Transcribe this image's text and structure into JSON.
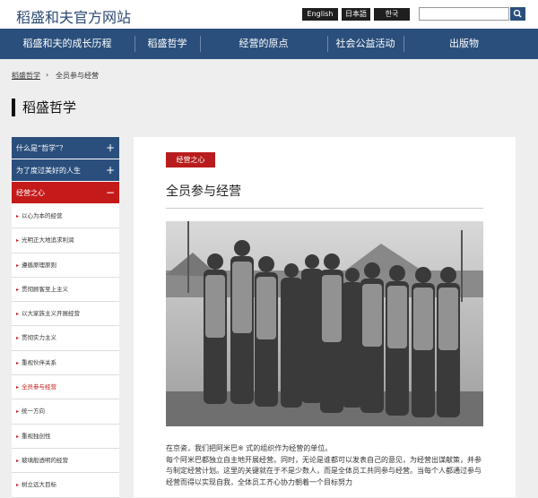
{
  "header": {
    "site_title": "稻盛和夫官方网站",
    "languages": [
      "English",
      "日本語",
      "한국"
    ],
    "search": {
      "value": ""
    }
  },
  "nav": [
    "稻盛和夫的成长历程",
    "稻盛哲学",
    "经营的原点",
    "社会公益活动",
    "出版物"
  ],
  "breadcrumb": {
    "home": "稻盛哲学",
    "separator": "›",
    "current": "全员参与经营"
  },
  "page_title": "稻盛哲学",
  "sidebar": {
    "sections": [
      {
        "label": "什么是“哲学”？",
        "toggle": "+"
      },
      {
        "label": "为了度过美好的人生",
        "toggle": "+"
      },
      {
        "label": "经营之心",
        "toggle": "−"
      }
    ],
    "items": [
      "以心为本的经营",
      "光明正大地追求利润",
      "遵循原理原则",
      "贯彻顾客至上主义",
      "以大家族主义开展经营",
      "贯彻实力主义",
      "重视伙伴关系",
      "全员参与经营",
      "统一方向",
      "重视独创性",
      "玻璃般透明的经营",
      "树立远大目标"
    ],
    "active_item": "全员参与经营"
  },
  "article": {
    "tag": "经营之心",
    "title": "全员参与经营",
    "paragraphs": [
      "在京瓷，我们把阿米巴※ 式的组织作为经营的单位。",
      "每个阿米巴都独立自主地开展经营。同时，无论是谁都可以发表自己的意见，为经营出谋献策，并参与制定经营计划。这里的关键就在于不是少数人，而是全体员工共同参与经营。当每个人都通过参与经营而得以实现自我，全体员工齐心协力朝着一个目标努力"
    ]
  },
  "colors": {
    "nav": "#2a4f7c",
    "accent_red": "#b81c1c",
    "sidebar_head": "#2a4f7c",
    "sidebar_active": "#c51a1a"
  }
}
